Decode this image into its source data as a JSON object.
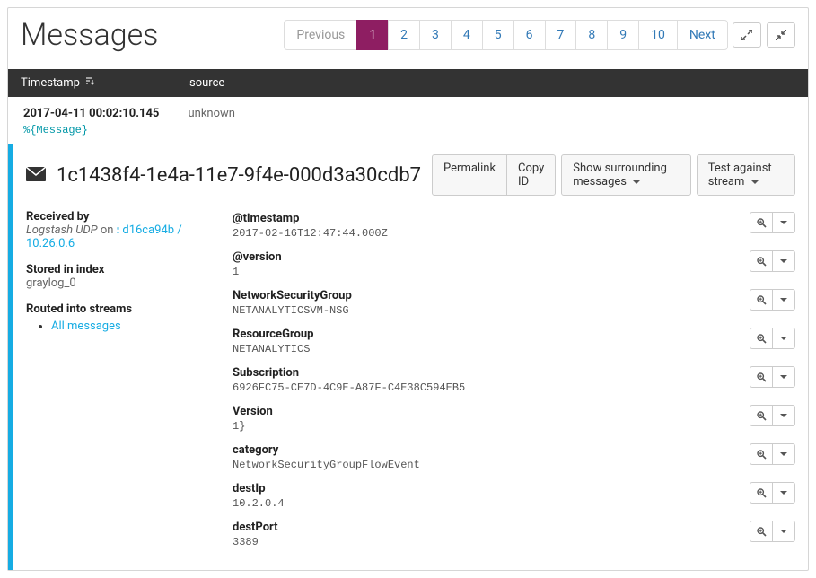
{
  "header": {
    "title": "Messages",
    "pagination": {
      "previous": "Previous",
      "next": "Next",
      "pages": [
        "1",
        "2",
        "3",
        "4",
        "5",
        "6",
        "7",
        "8",
        "9",
        "10"
      ],
      "active": "1"
    }
  },
  "table": {
    "columns": {
      "timestamp": "Timestamp",
      "source": "source"
    }
  },
  "row": {
    "timestamp": "2017-04-11 00:02:10.145",
    "source": "unknown",
    "placeholder": "%{Message}"
  },
  "detail": {
    "id": "1c1438f4-1e4a-11e7-9f4e-000d3a30cdb7",
    "buttons": {
      "permalink": "Permalink",
      "copy_id": "Copy ID",
      "surrounding": "Show surrounding messages",
      "test_stream": "Test against stream"
    },
    "meta": {
      "received_label": "Received by",
      "received_input": "Logstash UDP",
      "received_on": "on",
      "received_node": "d16ca94b / 10.26.0.6",
      "stored_label": "Stored in index",
      "stored_value": "graylog_0",
      "streams_label": "Routed into streams",
      "stream_link": "All messages"
    },
    "fields": [
      {
        "name": "@timestamp",
        "value": "2017-02-16T12:47:44.000Z"
      },
      {
        "name": "@version",
        "value": "1"
      },
      {
        "name": "NetworkSecurityGroup",
        "value": "NETANALYTICSVM-NSG"
      },
      {
        "name": "ResourceGroup",
        "value": "NETANALYTICS"
      },
      {
        "name": "Subscription",
        "value": "6926FC75-CE7D-4C9E-A87F-C4E38C594EB5"
      },
      {
        "name": "Version",
        "value": "1}"
      },
      {
        "name": "category",
        "value": "NetworkSecurityGroupFlowEvent"
      },
      {
        "name": "destIp",
        "value": "10.2.0.4"
      },
      {
        "name": "destPort",
        "value": "3389"
      }
    ]
  }
}
